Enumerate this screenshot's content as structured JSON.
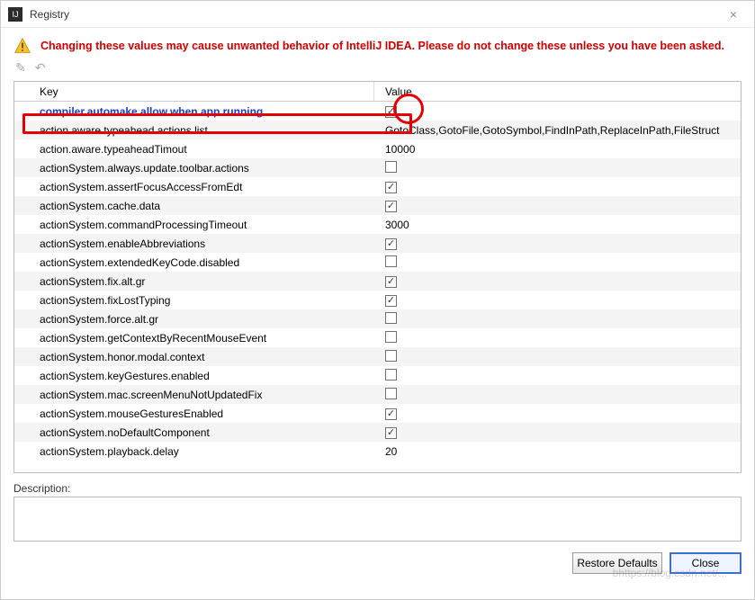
{
  "window": {
    "title": "Registry",
    "close": "×"
  },
  "warning": "Changing these values may cause unwanted behavior of IntelliJ IDEA. Please do not change these unless you have been asked.",
  "tools": {
    "edit": "✎",
    "revert": "↶"
  },
  "headers": {
    "key": "Key",
    "value": "Value"
  },
  "rows": [
    {
      "key": "compiler.automake.allow.when.app.running",
      "type": "check",
      "checked": true,
      "selected": true
    },
    {
      "key": "action.aware.typeahead.actions.list",
      "type": "text",
      "value": "GotoClass,GotoFile,GotoSymbol,FindInPath,ReplaceInPath,FileStruct"
    },
    {
      "key": "action.aware.typeaheadTimout",
      "type": "text",
      "value": "10000"
    },
    {
      "key": "actionSystem.always.update.toolbar.actions",
      "type": "check",
      "checked": false
    },
    {
      "key": "actionSystem.assertFocusAccessFromEdt",
      "type": "check",
      "checked": true
    },
    {
      "key": "actionSystem.cache.data",
      "type": "check",
      "checked": true
    },
    {
      "key": "actionSystem.commandProcessingTimeout",
      "type": "text",
      "value": "3000"
    },
    {
      "key": "actionSystem.enableAbbreviations",
      "type": "check",
      "checked": true
    },
    {
      "key": "actionSystem.extendedKeyCode.disabled",
      "type": "check",
      "checked": false
    },
    {
      "key": "actionSystem.fix.alt.gr",
      "type": "check",
      "checked": true
    },
    {
      "key": "actionSystem.fixLostTyping",
      "type": "check",
      "checked": true
    },
    {
      "key": "actionSystem.force.alt.gr",
      "type": "check",
      "checked": false
    },
    {
      "key": "actionSystem.getContextByRecentMouseEvent",
      "type": "check",
      "checked": false
    },
    {
      "key": "actionSystem.honor.modal.context",
      "type": "check",
      "checked": false
    },
    {
      "key": "actionSystem.keyGestures.enabled",
      "type": "check",
      "checked": false
    },
    {
      "key": "actionSystem.mac.screenMenuNotUpdatedFix",
      "type": "check",
      "checked": false
    },
    {
      "key": "actionSystem.mouseGesturesEnabled",
      "type": "check",
      "checked": true
    },
    {
      "key": "actionSystem.noDefaultComponent",
      "type": "check",
      "checked": true
    },
    {
      "key": "actionSystem.playback.delay",
      "type": "text",
      "value": "20"
    }
  ],
  "description_label": "Description:",
  "buttons": {
    "restore": "Restore Defaults",
    "close": "Close"
  }
}
